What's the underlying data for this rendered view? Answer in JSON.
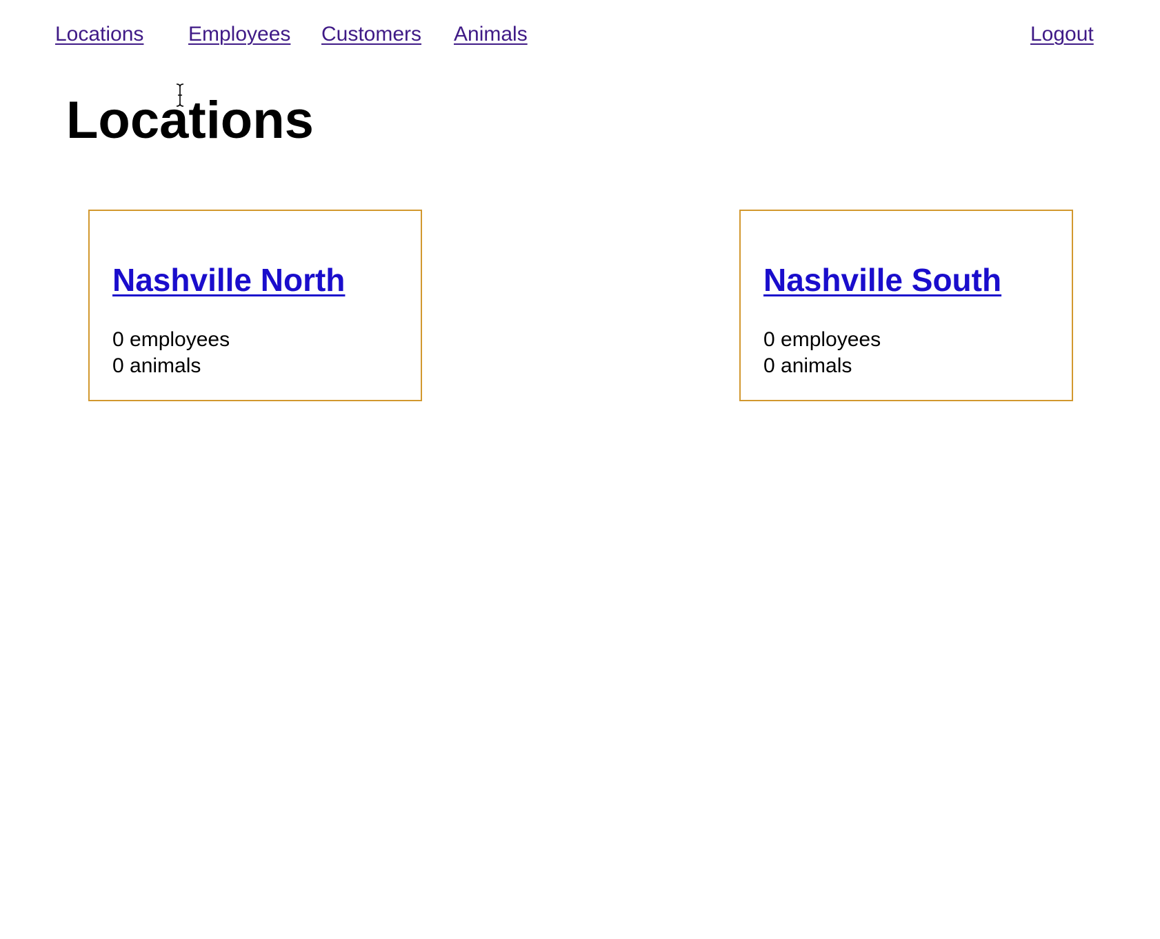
{
  "nav": {
    "locations": "Locations",
    "employees": "Employees",
    "customers": "Customers",
    "animals": "Animals",
    "logout": "Logout"
  },
  "page": {
    "title": "Locations"
  },
  "locations": [
    {
      "name": "Nashville North",
      "employees": "0 employees",
      "animals": "0 animals"
    },
    {
      "name": "Nashville South",
      "employees": "0 employees",
      "animals": "0 animals"
    }
  ],
  "colors": {
    "nav_link": "#3f1a86",
    "card_link": "#1a0dcc",
    "card_border": "#d2982e",
    "background": "#ffffff"
  },
  "icons": {
    "cursor": "i-beam-cursor-icon"
  }
}
